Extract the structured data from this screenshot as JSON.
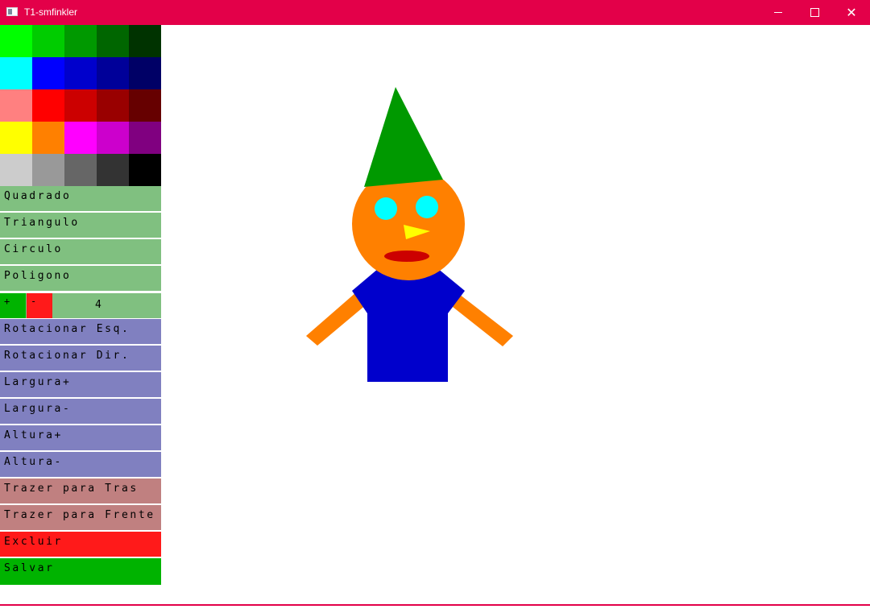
{
  "window": {
    "title": "T1-smfinkler",
    "minimize_glyph": "—",
    "maximize_glyph": "☐",
    "close_glyph": "✕",
    "accent": "#e30049"
  },
  "palette": {
    "colors": [
      [
        "#00ff00",
        "#00cc00",
        "#009900",
        "#006600",
        "#003300"
      ],
      [
        "#00ffff",
        "#0000ff",
        "#0000cc",
        "#000099",
        "#000066"
      ],
      [
        "#ff8080",
        "#ff0000",
        "#cc0000",
        "#990000",
        "#660000"
      ],
      [
        "#ffff00",
        "#ff8000",
        "#ff00ff",
        "#cc00cc",
        "#800080"
      ],
      [
        "#cccccc",
        "#999999",
        "#666666",
        "#333333",
        "#000000"
      ]
    ]
  },
  "tools": {
    "quadrado": "Quadrado",
    "triangulo": "Triangulo",
    "circulo": "Circulo",
    "poligono": "Poligono",
    "sides_inc": "+",
    "sides_dec": "-",
    "sides_count": "4",
    "rot_esq": "Rotacionar Esq.",
    "rot_dir": "Rotacionar Dir.",
    "largura_mais": "Largura+",
    "largura_menos": "Largura-",
    "altura_mais": "Altura+",
    "altura_menos": "Altura-",
    "trazer_tras": "Trazer para Tras",
    "trazer_frente": "Trazer para Frente",
    "excluir": "Excluir",
    "salvar": "Salvar"
  },
  "drawing": {
    "shapes": [
      {
        "name": "left-arm",
        "type": "polygon",
        "color": "#ff8000"
      },
      {
        "name": "right-arm",
        "type": "polygon",
        "color": "#ff8000"
      },
      {
        "name": "body",
        "type": "polygon",
        "color": "#0000cc"
      },
      {
        "name": "head",
        "type": "circle",
        "color": "#ff8000"
      },
      {
        "name": "hat",
        "type": "triangle",
        "color": "#009900"
      },
      {
        "name": "left-eye",
        "type": "circle",
        "color": "#00ffff"
      },
      {
        "name": "right-eye",
        "type": "circle",
        "color": "#00ffff"
      },
      {
        "name": "nose",
        "type": "triangle",
        "color": "#ffff00"
      },
      {
        "name": "mouth",
        "type": "ellipse",
        "color": "#cc0000"
      }
    ]
  }
}
